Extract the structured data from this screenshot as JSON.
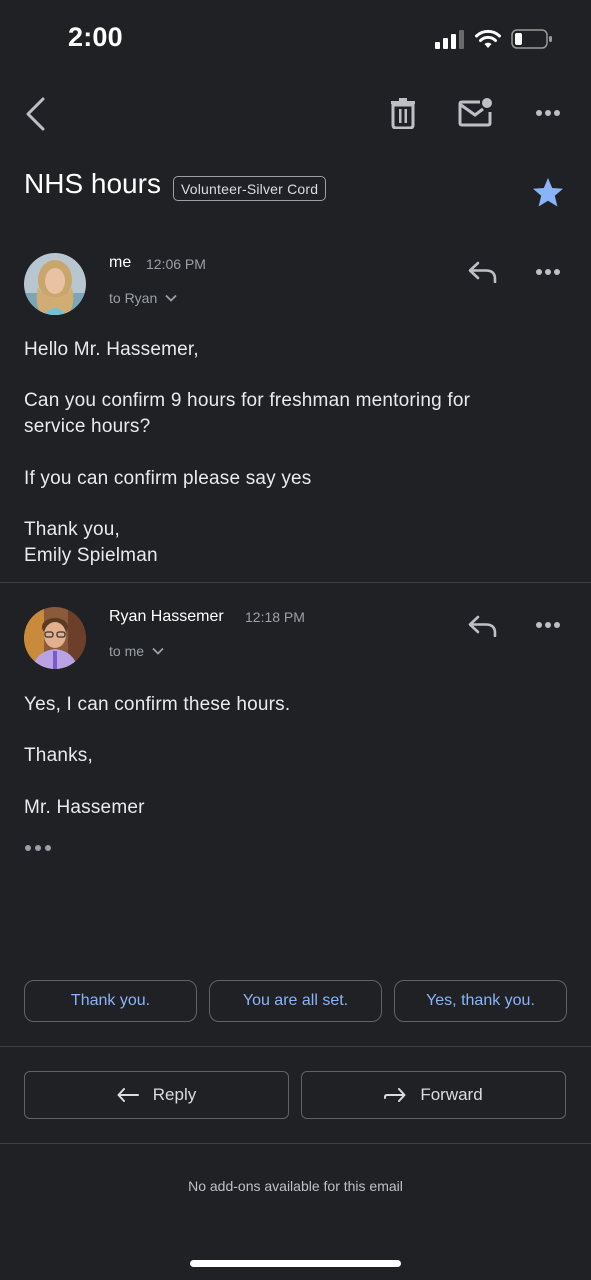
{
  "status_bar": {
    "time": "2:00"
  },
  "email": {
    "subject": "NHS hours",
    "label": "Volunteer-Silver Cord",
    "starred": true
  },
  "messages": [
    {
      "sender": "me",
      "time": "12:06 PM",
      "recipients": "to Ryan",
      "body": [
        "Hello Mr. Hassemer,",
        "Can you confirm 9 hours for freshman mentoring for service hours?",
        "If you can confirm please say yes",
        "Thank you,",
        "Emily Spielman"
      ]
    },
    {
      "sender": "Ryan Hassemer",
      "time": "12:18 PM",
      "recipients": "to me",
      "body": [
        "Yes, I can confirm these hours.",
        "Thanks,",
        "Mr. Hassemer"
      ]
    }
  ],
  "smart_replies": [
    "Thank you.",
    "You are all set.",
    "Yes, thank you."
  ],
  "actions": {
    "reply": "Reply",
    "forward": "Forward"
  },
  "addons_text": "No add-ons available for this email",
  "colors": {
    "background": "#202124",
    "accent": "#8ab4f8",
    "star": "#8ab4f8"
  }
}
